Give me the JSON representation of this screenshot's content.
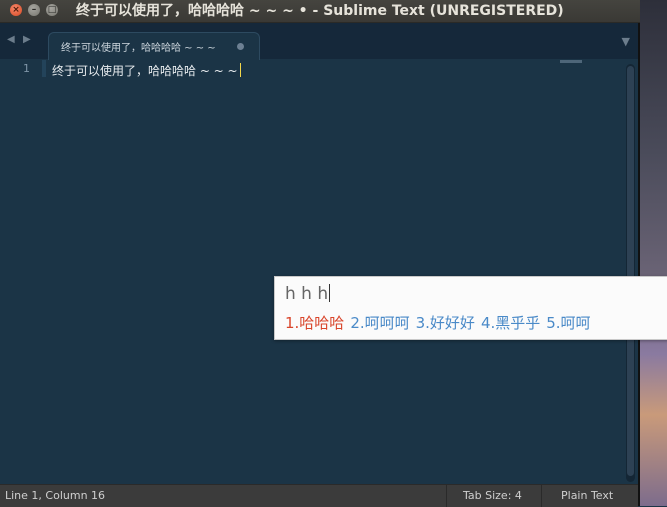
{
  "window": {
    "title": "终于可以使用了，哈哈哈哈 ~ ~ ~ • - Sublime Text (UNREGISTERED)",
    "close_glyph": "×",
    "min_glyph": "–",
    "max_glyph": "□"
  },
  "tabs": {
    "nav_left": "◀",
    "nav_right": "▶",
    "active_label": "终于可以使用了，哈哈哈哈 ~ ~ ~",
    "menu_glyph": "▼"
  },
  "editor": {
    "line_number": "1",
    "line_text": "终于可以使用了，哈哈哈哈 ~ ~ ~"
  },
  "ime": {
    "input": "h h h",
    "candidates": [
      "1.哈哈哈",
      "2.呵呵呵",
      "3.好好好",
      "4.黑乎乎",
      "5.呵呵"
    ],
    "selected_index": 0
  },
  "statusbar": {
    "position": "Line 1, Column 16",
    "tab_size": "Tab Size: 4",
    "syntax": "Plain Text"
  },
  "colors": {
    "editor_bg": "#1b3446",
    "cursor": "#f2d64b",
    "candidate": "#4a8ac8",
    "candidate_selected": "#d9452b"
  }
}
